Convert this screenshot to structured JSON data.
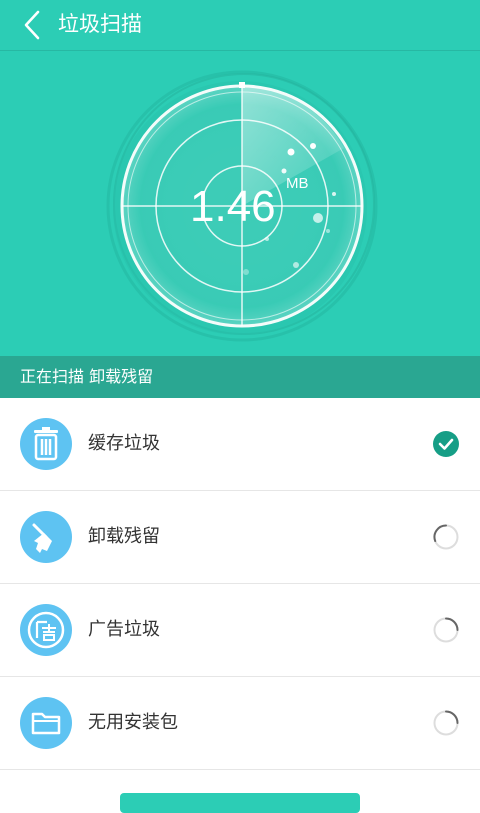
{
  "header": {
    "title": "垃圾扫描"
  },
  "scan": {
    "size_value": "1.46",
    "size_unit": "MB"
  },
  "status": {
    "text": "正在扫描 卸载残留"
  },
  "items": [
    {
      "label": "缓存垃圾",
      "state": "done"
    },
    {
      "label": "卸载残留",
      "state": "scanning"
    },
    {
      "label": "广告垃圾",
      "state": "pending"
    },
    {
      "label": "无用安装包",
      "state": "pending"
    }
  ],
  "colors": {
    "accent": "#2ccdb5",
    "status_bar": "#2aa792",
    "icon_bg": "#5ec3f2",
    "check": "#169e86"
  },
  "icons": [
    "back-arrow-icon",
    "trash-icon",
    "broom-icon",
    "ad-icon",
    "folder-icon",
    "check-icon",
    "spinner-icon"
  ]
}
